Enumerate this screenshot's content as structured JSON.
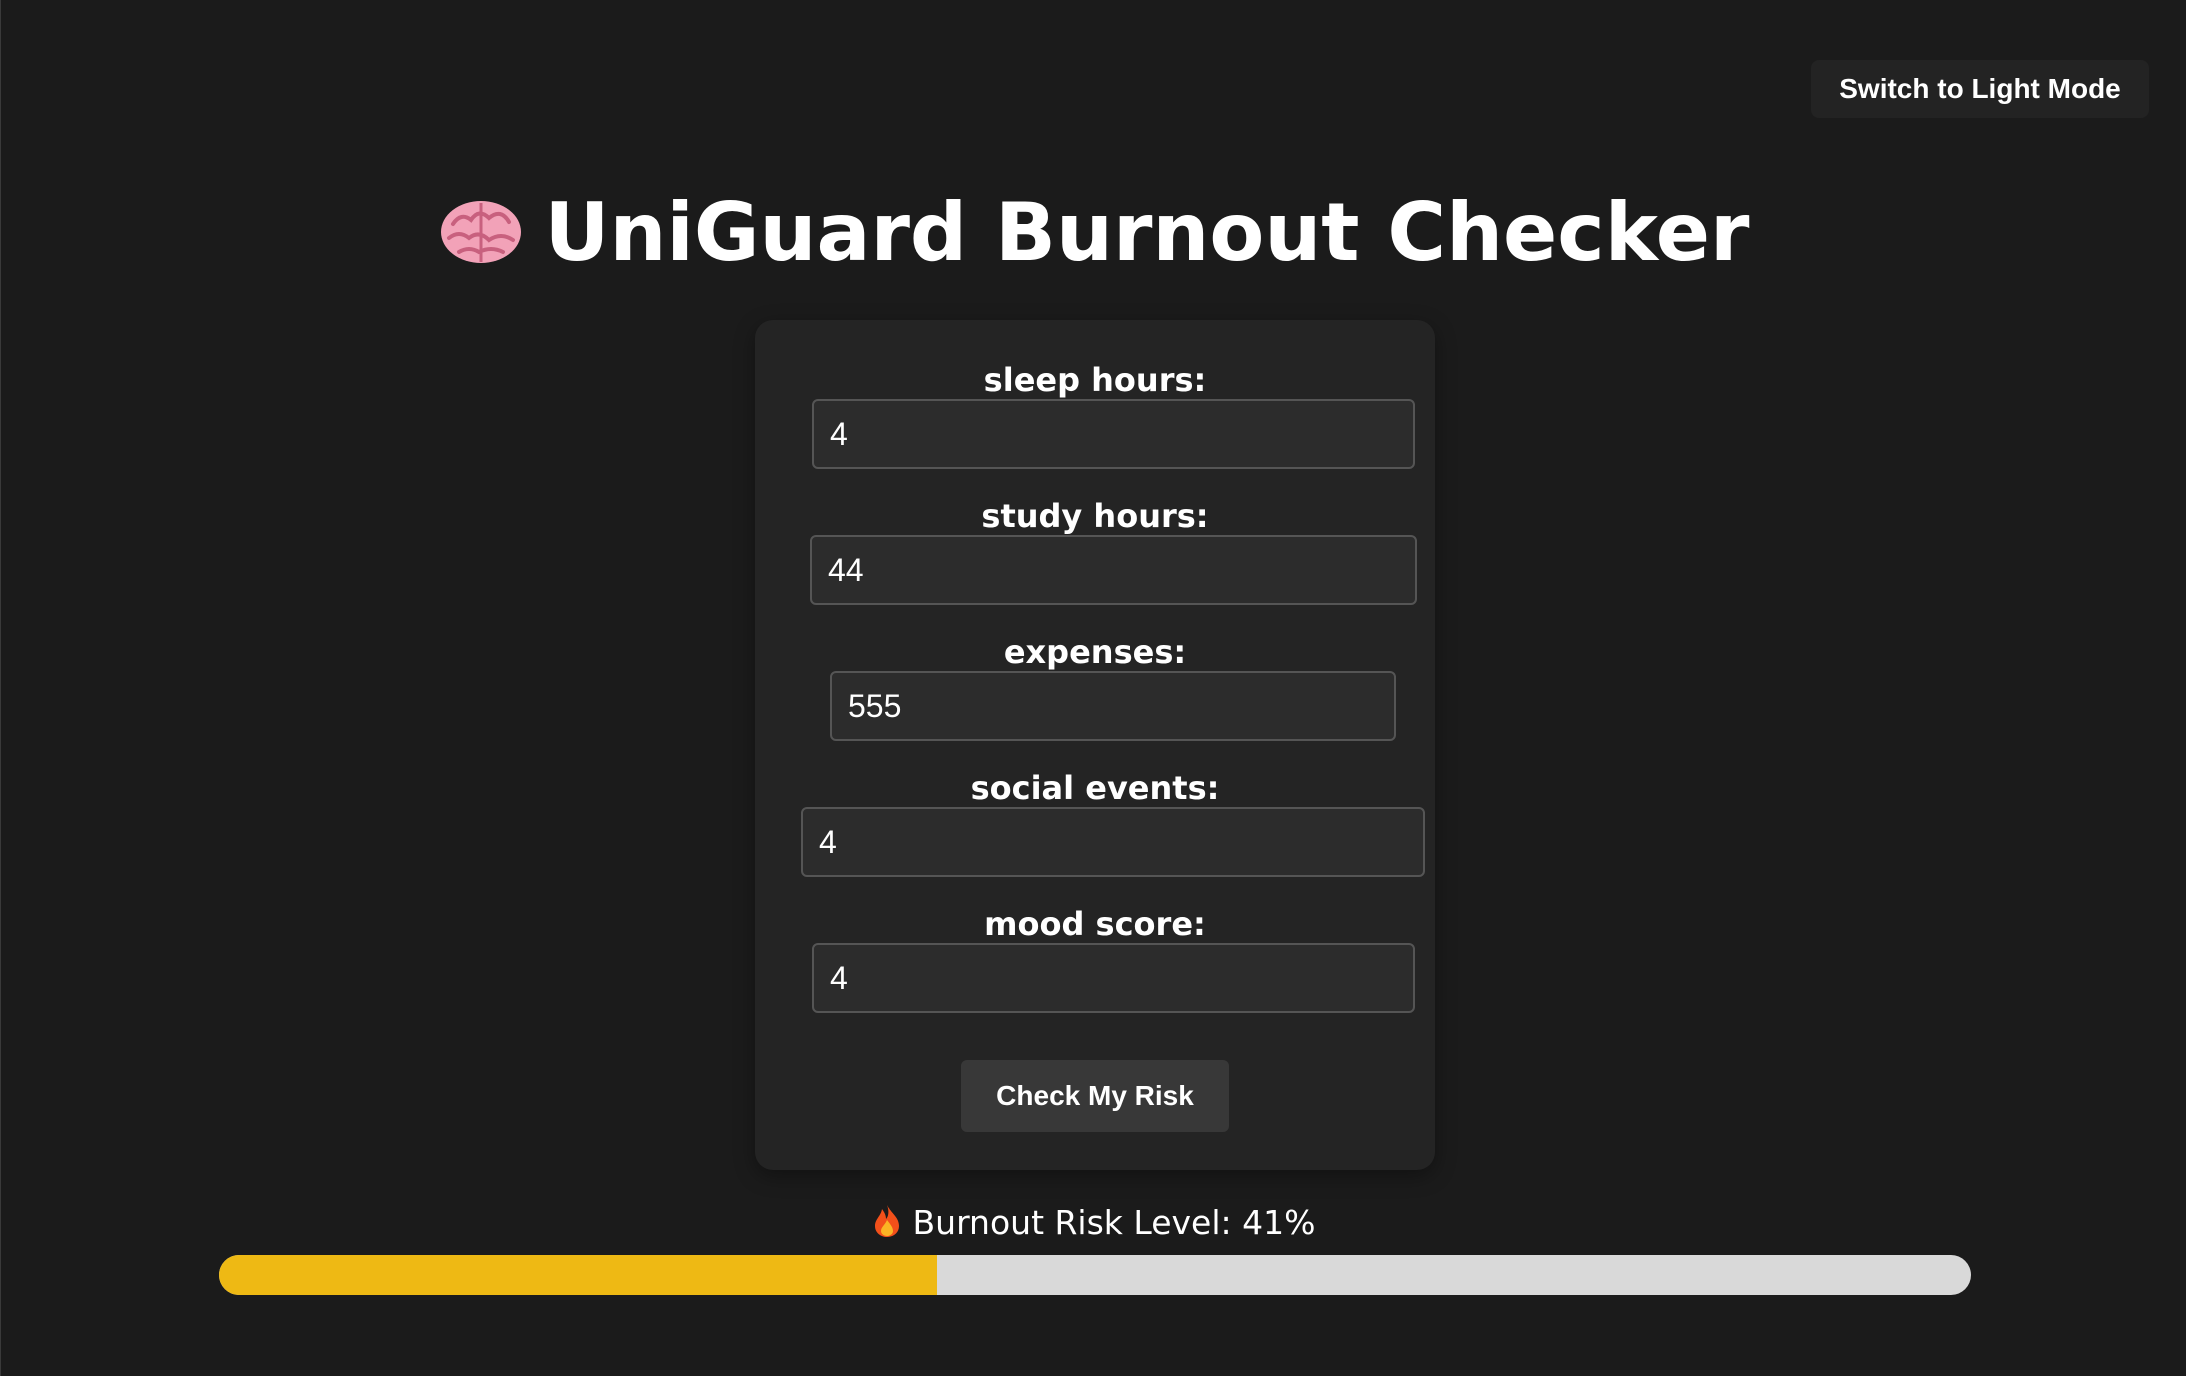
{
  "header": {
    "theme_toggle_label": "Switch to Light Mode",
    "title": "UniGuard Burnout Checker",
    "title_icon": "brain-icon"
  },
  "form": {
    "fields": [
      {
        "label": "sleep hours:",
        "value": "4"
      },
      {
        "label": "study hours:",
        "value": "44"
      },
      {
        "label": "expenses:",
        "value": "555"
      },
      {
        "label": "social events:",
        "value": "4"
      },
      {
        "label": "mood score:",
        "value": "4"
      }
    ],
    "submit_label": "Check My Risk"
  },
  "result": {
    "icon": "fire-icon",
    "label": "Burnout Risk Level: 41%",
    "risk_percent": 41
  },
  "colors": {
    "background": "#1b1b1b",
    "card": "#242424",
    "progress_fill": "#eeb914",
    "progress_track": "#d9d9d9"
  }
}
